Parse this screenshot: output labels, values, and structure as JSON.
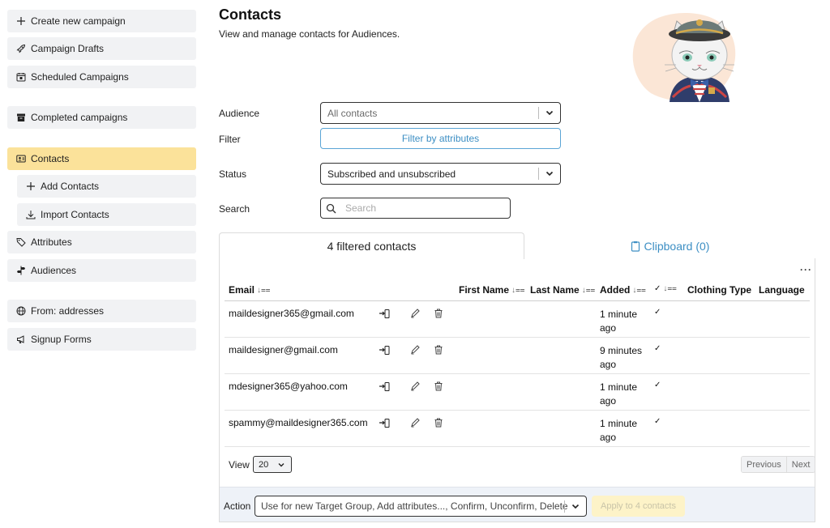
{
  "sidebar": {
    "items": [
      {
        "label": "Create new campaign",
        "icon": "plus-icon"
      },
      {
        "label": "Campaign Drafts",
        "icon": "rocket-icon"
      },
      {
        "label": "Scheduled Campaigns",
        "icon": "calendar-icon"
      },
      {
        "label": "Completed campaigns",
        "icon": "archive-icon"
      },
      {
        "label": "Contacts",
        "icon": "contact-card-icon",
        "active": true
      },
      {
        "label": "Add Contacts",
        "icon": "plus-icon"
      },
      {
        "label": "Import Contacts",
        "icon": "download-icon"
      },
      {
        "label": "Attributes",
        "icon": "tag-icon"
      },
      {
        "label": "Audiences",
        "icon": "signpost-icon"
      },
      {
        "label": "From: addresses",
        "icon": "globe-icon"
      },
      {
        "label": "Signup Forms",
        "icon": "megaphone-icon"
      }
    ]
  },
  "header": {
    "title": "Contacts",
    "subtitle": "View and manage contacts for Audiences."
  },
  "form": {
    "audience_label": "Audience",
    "audience_value": "All contacts",
    "filter_label": "Filter",
    "filter_button": "Filter by attributes",
    "status_label": "Status",
    "status_value": "Subscribed and unsubscribed",
    "search_label": "Search",
    "search_placeholder": "Search"
  },
  "tabs": {
    "filtered": "4 filtered contacts",
    "clipboard": "Clipboard (0)"
  },
  "table": {
    "more": "···",
    "columns": {
      "email": "Email",
      "first_name": "First Name",
      "last_name": "Last Name",
      "added": "Added",
      "check": "✓",
      "clothing": "Clothing Type",
      "language": "Language"
    },
    "rows": [
      {
        "email": "maildesigner365@gmail.com",
        "added": "1 minute ago",
        "confirmed": "✓"
      },
      {
        "email": "maildesigner@gmail.com",
        "added": "9 minutes ago",
        "confirmed": "✓"
      },
      {
        "email": "mdesigner365@yahoo.com",
        "added": "1 minute ago",
        "confirmed": "✓"
      },
      {
        "email": "spammy@maildesigner365.com",
        "added": "1 minute ago",
        "confirmed": "✓"
      }
    ]
  },
  "footer": {
    "view_label": "View",
    "view_value": "20",
    "prev": "Previous",
    "next": "Next",
    "action_label": "Action",
    "action_value": "Use for new Target Group, Add attributes..., Confirm, Unconfirm, Delete",
    "apply": "Apply to 4 contacts"
  },
  "colors": {
    "active_nav": "#fbe29a",
    "nav_bg": "#f1f2f4",
    "link_blue": "#3d8fc4",
    "action_bar": "#eef2f8"
  }
}
